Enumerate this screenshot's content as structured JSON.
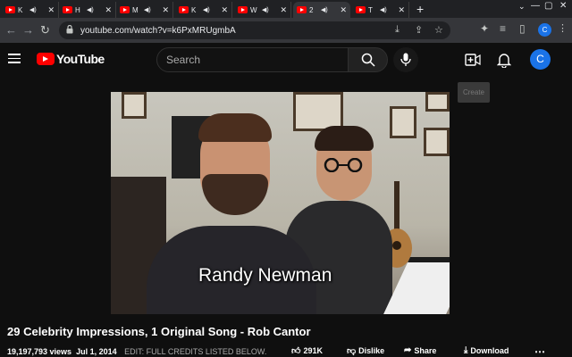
{
  "browser": {
    "tabs": [
      {
        "title": "K",
        "active": false
      },
      {
        "title": "H",
        "active": false
      },
      {
        "title": "M",
        "active": false
      },
      {
        "title": "K",
        "active": false
      },
      {
        "title": "W",
        "active": false
      },
      {
        "title": "2",
        "active": true
      },
      {
        "title": "T",
        "active": false
      }
    ],
    "url": "youtube.com/watch?v=k6PxMRUgmbA",
    "profile_initial": "C"
  },
  "youtube": {
    "logo_text": "YouTube",
    "search_placeholder": "Search",
    "avatar_initial": "C",
    "create_tooltip": "Create",
    "colors": {
      "brand": "#ff0000",
      "avatar": "#1a73e8"
    }
  },
  "video": {
    "caption": "Randy Newman",
    "title": "29 Celebrity Impressions, 1 Original Song - Rob Cantor",
    "views": "19,197,793 views",
    "date": "Jul 1, 2014",
    "description_preview": "EDIT: FULL CREDITS LISTED BELOW.",
    "likes": "291K",
    "dislike_label": "Dislike",
    "share_label": "Share",
    "download_label": "Download"
  }
}
